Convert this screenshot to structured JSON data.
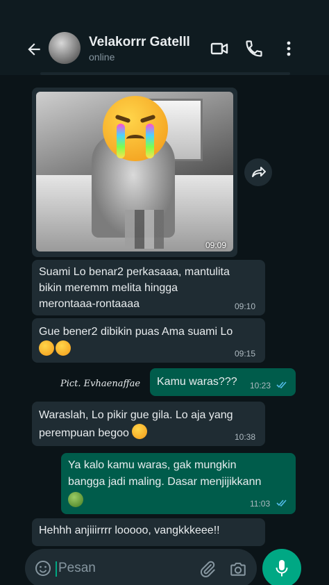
{
  "header": {
    "contact_name": "Velakorrr Gatelll",
    "status": "online"
  },
  "photo_message": {
    "time": "09:09",
    "emoji_overlay": "loudly-crying-face"
  },
  "messages": [
    {
      "direction": "in",
      "text_line1": "Suami Lo benar2 perkasaaa, mantulita",
      "text_line2": "bikin meremm melita hingga",
      "text_line3": "merontaaa-rontaaaa",
      "time": "09:10"
    },
    {
      "direction": "in",
      "text_line1": "Gue bener2 dibikin puas Ama suami Lo",
      "emoji": "rolling-on-floor-laughing x2",
      "time": "09:15"
    },
    {
      "direction": "out",
      "text_line1": "Kamu waras???",
      "time": "10:23",
      "read": true
    },
    {
      "direction": "in",
      "text_line1": "Waraslah, Lo pikir gue gila. Lo aja yang",
      "text_line2": "perempuan begoo",
      "emoji": "rolling-on-floor-laughing",
      "time": "10:38"
    },
    {
      "direction": "out",
      "text_line1": "Ya kalo kamu waras, gak mungkin",
      "text_line2": "bangga jadi maling. Dasar menjijikkann",
      "emoji": "face-vomiting",
      "time": "11:03",
      "read": true
    },
    {
      "direction": "in",
      "text_line1": "Hehhh anjiiirrrr looooo, vangkkkeee!!"
    }
  ],
  "watermark": "Pict. Evhaenaffae",
  "composer": {
    "placeholder": "Pesan"
  },
  "colors": {
    "incoming_bubble": "#1f2c33",
    "outgoing_bubble": "#005c4b",
    "accent": "#00a884",
    "read_ticks": "#53bdeb"
  }
}
